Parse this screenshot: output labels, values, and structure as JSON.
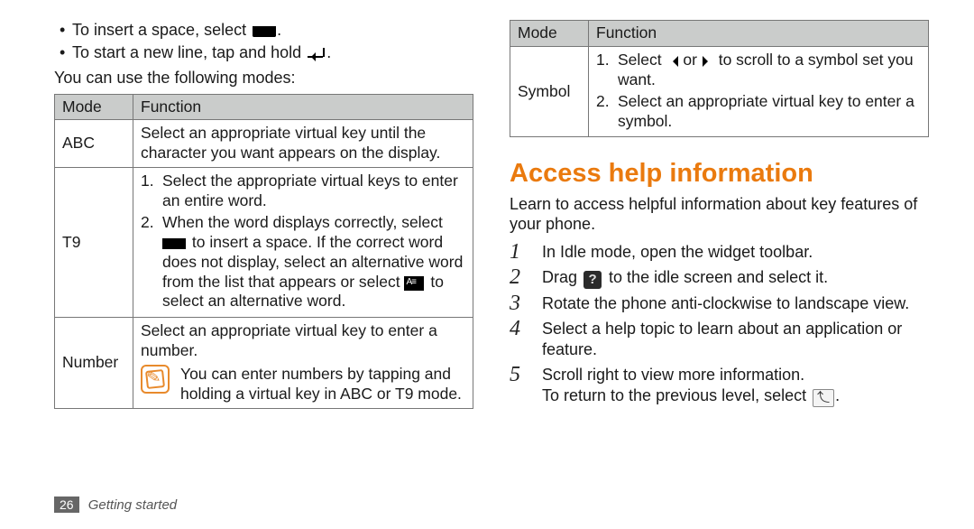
{
  "intro": {
    "bullets": [
      "To insert a space, select",
      "To start a new line, tap and hold"
    ],
    "modes_lead": "You can use the following modes:"
  },
  "table1": {
    "head_mode": "Mode",
    "head_func": "Function",
    "row_abc_mode": "ABC",
    "row_abc_func": "Select an appropriate virtual key until the character you want appears on the display.",
    "row_t9_mode": "T9",
    "row_t9_s1": "Select the appropriate virtual keys to enter an entire word.",
    "row_t9_s2a": "When the word displays correctly, select",
    "row_t9_s2b": "to insert a space. If the correct word does not display, select an alternative word from the list that appears or select",
    "row_t9_s2c": "to select an alternative word.",
    "row_num_mode": "Number",
    "row_num_top": "Select an appropriate virtual key to enter a number.",
    "row_num_note": "You can enter numbers by tapping and holding a virtual key in ABC or T9 mode."
  },
  "table2": {
    "head_mode": "Mode",
    "head_func": "Function",
    "row_sym_mode": "Symbol",
    "row_sym_s1a": "Select",
    "row_sym_s1b": "or",
    "row_sym_s1c": "to scroll to a symbol set you want.",
    "row_sym_s2": "Select an appropriate virtual key to enter a symbol."
  },
  "access": {
    "heading": "Access help information",
    "lead": "Learn to access helpful information about key features of your phone.",
    "steps": {
      "s1": "In Idle mode, open the widget toolbar.",
      "s2a": "Drag",
      "s2b": "to the idle screen and select it.",
      "s3": "Rotate the phone anti-clockwise to landscape view.",
      "s4": "Select a help topic to learn about an application or feature.",
      "s5": "Scroll right to view more information.",
      "s5b": "To return to the previous level, select"
    }
  },
  "footer": {
    "page": "26",
    "chapter": "Getting started"
  }
}
